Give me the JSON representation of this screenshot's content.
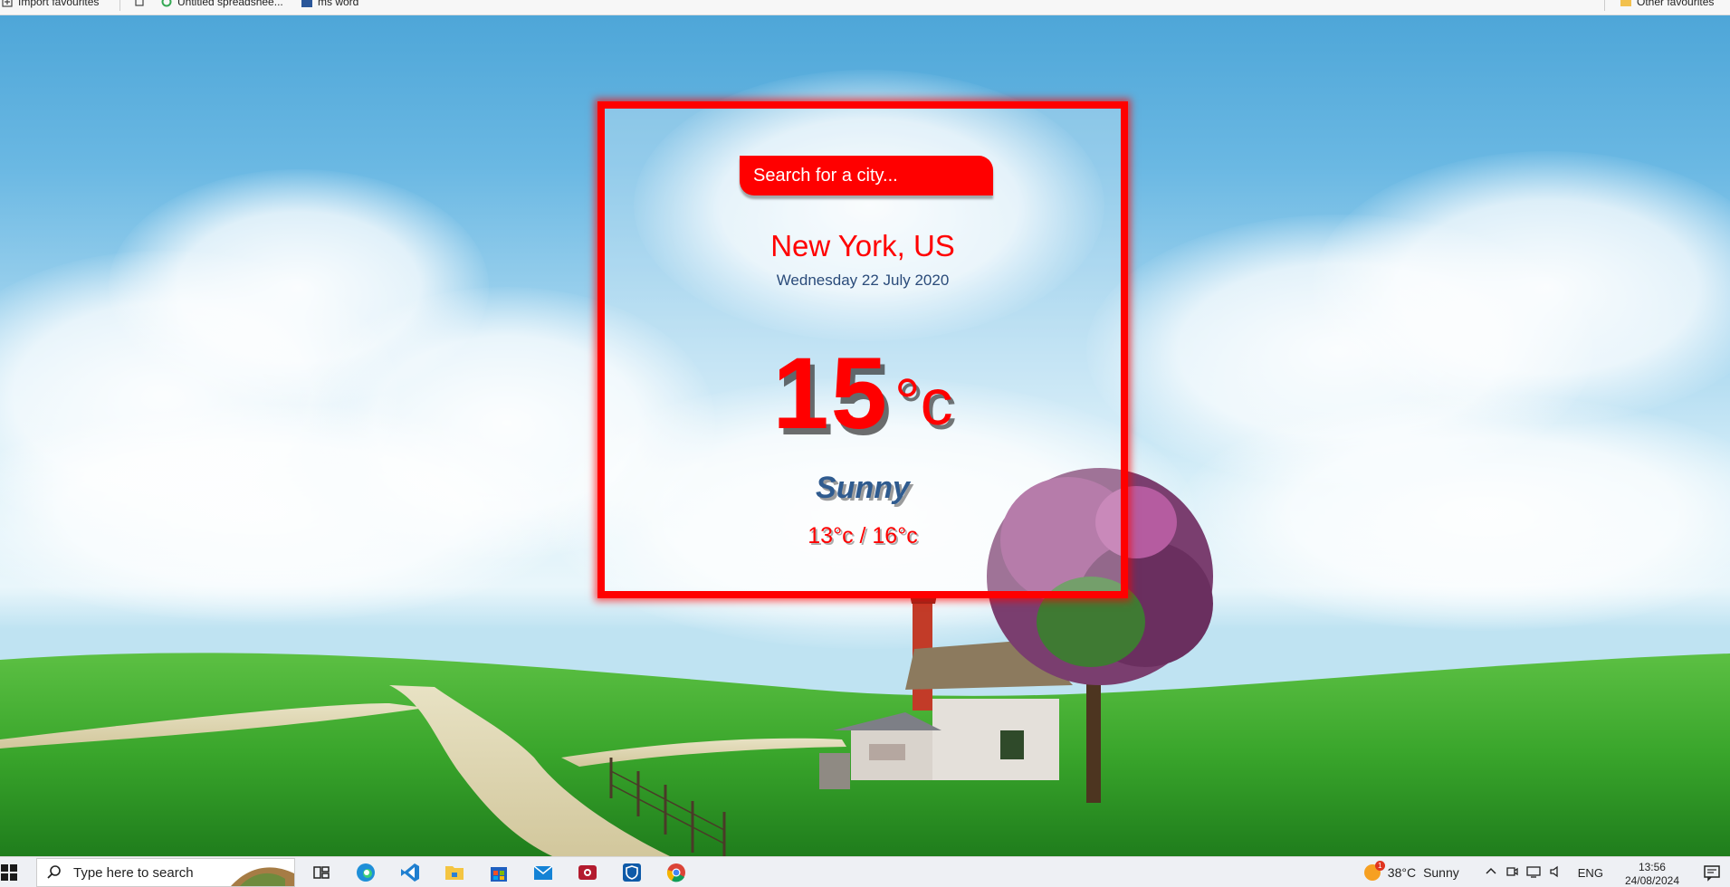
{
  "bookmarks": {
    "import_label": "Import favourites",
    "sheet_label": "Untitled spreadshee...",
    "word_label": "ms word",
    "other_label": "Other favourites"
  },
  "weather": {
    "search_placeholder": "Search for a city...",
    "city": "New York, US",
    "date": "Wednesday 22 July 2020",
    "temperature": "15",
    "unit": "°c",
    "condition": "Sunny",
    "hi_lo": "13°c / 16°c"
  },
  "taskbar": {
    "search_placeholder": "Type here to search",
    "apps": [
      "task-view-icon",
      "edge-icon",
      "vscode-icon",
      "file-explorer-icon",
      "store-icon",
      "mail-icon",
      "camera-app-icon",
      "security-app-icon",
      "chrome-icon"
    ],
    "weather_temp": "38°C",
    "weather_condition": "Sunny",
    "weather_badge": "1",
    "language": "ENG",
    "time": "13:56",
    "date": "24/08/2024"
  },
  "colors": {
    "accent_red": "#ff0000",
    "text_blue": "#2a4b7a",
    "condition_blue": "#2f5b8f"
  }
}
